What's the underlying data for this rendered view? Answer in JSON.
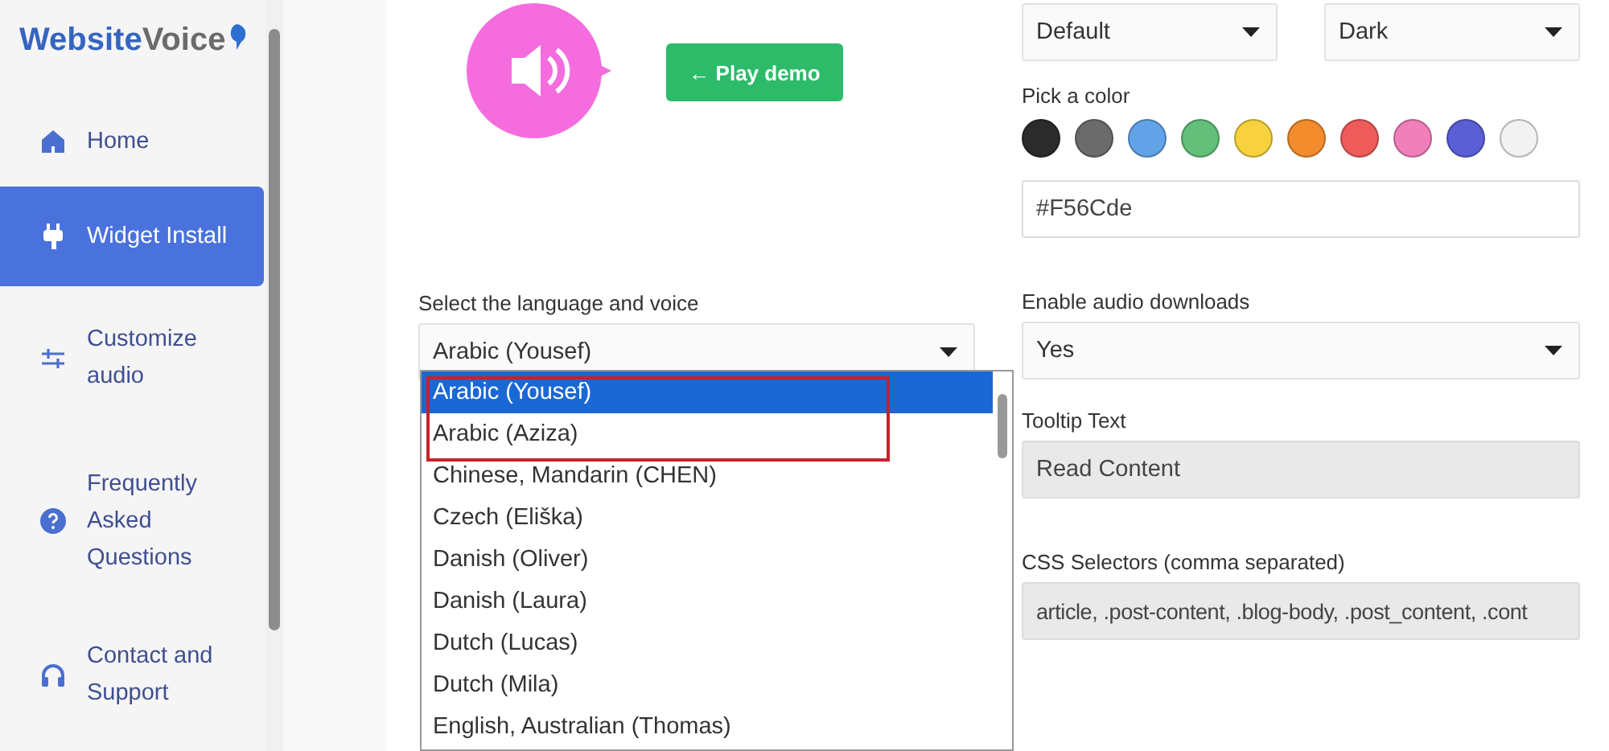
{
  "sidebar": {
    "logo": {
      "part_1": "Website",
      "part_2": "Voice"
    },
    "items": [
      {
        "label": "Home",
        "kind": "home",
        "selected": false
      },
      {
        "label": "Widget Install",
        "kind": "plug",
        "selected": true
      },
      {
        "label": "Customize audio",
        "kind": "sliders",
        "selected": false
      },
      {
        "label": "Frequently Asked Questions",
        "kind": "question",
        "selected": false
      },
      {
        "label": "Contact and Support",
        "kind": "headset",
        "selected": false
      }
    ]
  },
  "preview": {
    "play_button": "← Play demo"
  },
  "language": {
    "label": "Select the language and voice",
    "value": "Arabic (Yousef)",
    "options": [
      {
        "label": "Arabic (Yousef)",
        "selected": true
      },
      {
        "label": "Arabic (Aziza)",
        "selected": false
      },
      {
        "label": "Chinese, Mandarin (CHEN)",
        "selected": false
      },
      {
        "label": "Czech (Eliška)",
        "selected": false
      },
      {
        "label": "Danish (Oliver)",
        "selected": false
      },
      {
        "label": "Danish (Laura)",
        "selected": false
      },
      {
        "label": "Dutch (Lucas)",
        "selected": false
      },
      {
        "label": "Dutch (Mila)",
        "selected": false
      },
      {
        "label": "English, Australian (Thomas)",
        "selected": false
      }
    ]
  },
  "top_selects": [
    "Default",
    "Dark"
  ],
  "color_picker": {
    "label": "Pick a color",
    "value": "#F56Cde",
    "swatches": [
      {
        "color": "#2b2b2b"
      },
      {
        "color": "#6b6b6b"
      },
      {
        "color": "#62a3e8"
      },
      {
        "color": "#63bf7a"
      },
      {
        "color": "#f7d23e"
      },
      {
        "color": "#f28c2c"
      },
      {
        "color": "#ef5b5b"
      },
      {
        "color": "#f17fba"
      },
      {
        "color": "#5a5fd6"
      },
      {
        "color": "#f2f2f2"
      }
    ]
  },
  "audio_downloads": {
    "label": "Enable audio downloads",
    "value": "Yes"
  },
  "tooltip": {
    "label": "Tooltip Text",
    "value": "Read Content",
    "disabled": true
  },
  "css_selectors": {
    "label": "CSS Selectors (comma separated)",
    "value": "article, .post-content, .blog-body, .post_content, .cont",
    "disabled": true
  }
}
